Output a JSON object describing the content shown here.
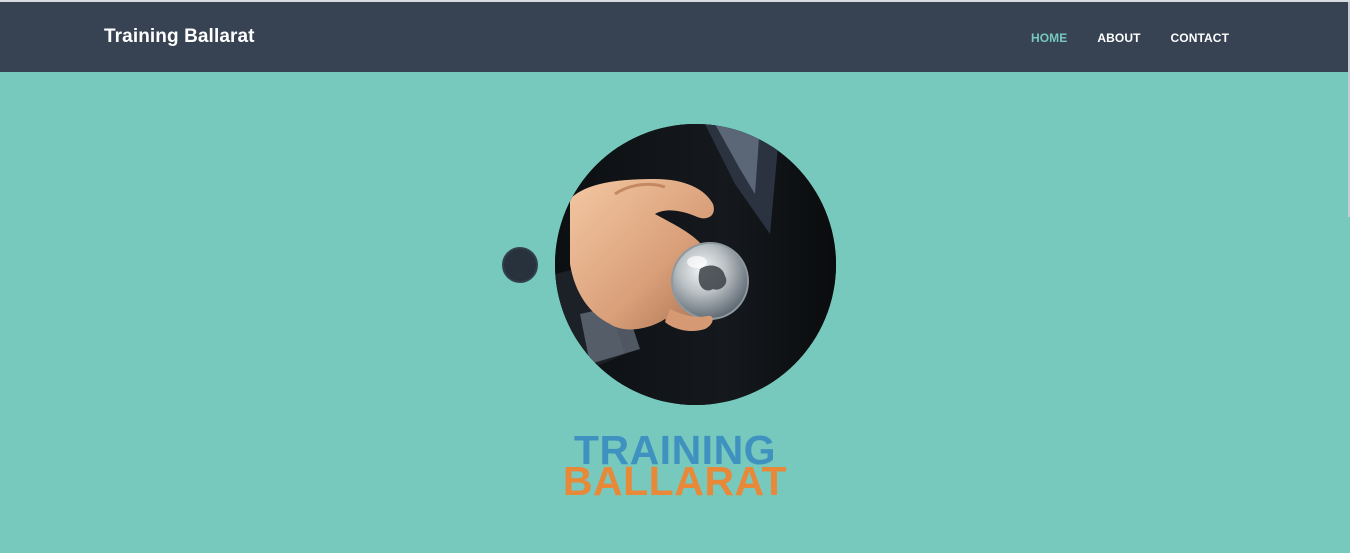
{
  "header": {
    "brand": "Training Ballarat",
    "nav": [
      {
        "label": "HOME",
        "active": true
      },
      {
        "label": "ABOUT",
        "active": false
      },
      {
        "label": "CONTACT",
        "active": false
      }
    ]
  },
  "hero": {
    "image_description": "hand holding a crystal globe",
    "logo_line1": "TRAINING",
    "logo_line2": "BALLARAT"
  },
  "colors": {
    "navbar": "#374353",
    "background": "#76c9bc",
    "active_link": "#76c9bc",
    "logo_blue": "#3f92c0",
    "logo_orange": "#e8893a"
  }
}
